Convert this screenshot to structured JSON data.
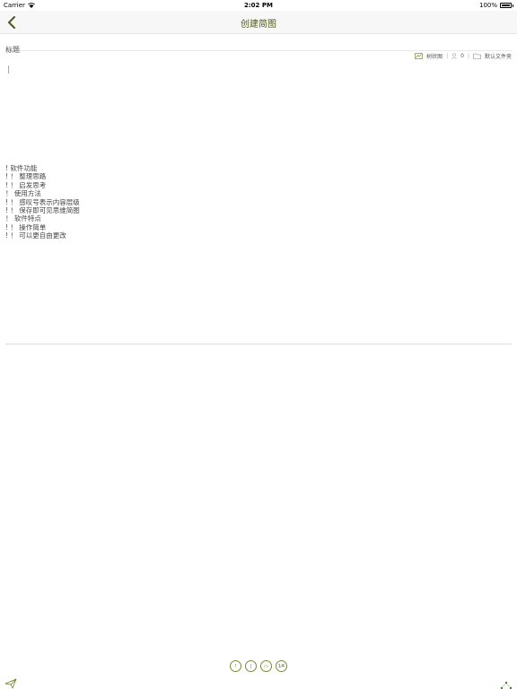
{
  "status_bar": {
    "carrier": "Carrier",
    "time": "2:02 PM",
    "battery": "100%"
  },
  "nav": {
    "title": "创建简图"
  },
  "title_field": {
    "placeholder": "标题",
    "value": ""
  },
  "meta": {
    "view_mode": "树状图",
    "count": "0",
    "folder": "默认文件夹"
  },
  "outline": [
    "! 软件功能",
    "! ！ 整理思路",
    "! ！ 启发思考",
    "！ 使用方法",
    "! ！ 感叹号表示内容层级",
    "! ！ 保存即可见思维简图",
    "！ 软件特点",
    "! ！ 操作简单",
    "! ！ 可以更自由更改"
  ],
  "tools": [
    "!",
    "|",
    "▭",
    "1⁄4"
  ],
  "colors": {
    "accent": "#4a5a1e",
    "tool": "#7a8a3a"
  }
}
